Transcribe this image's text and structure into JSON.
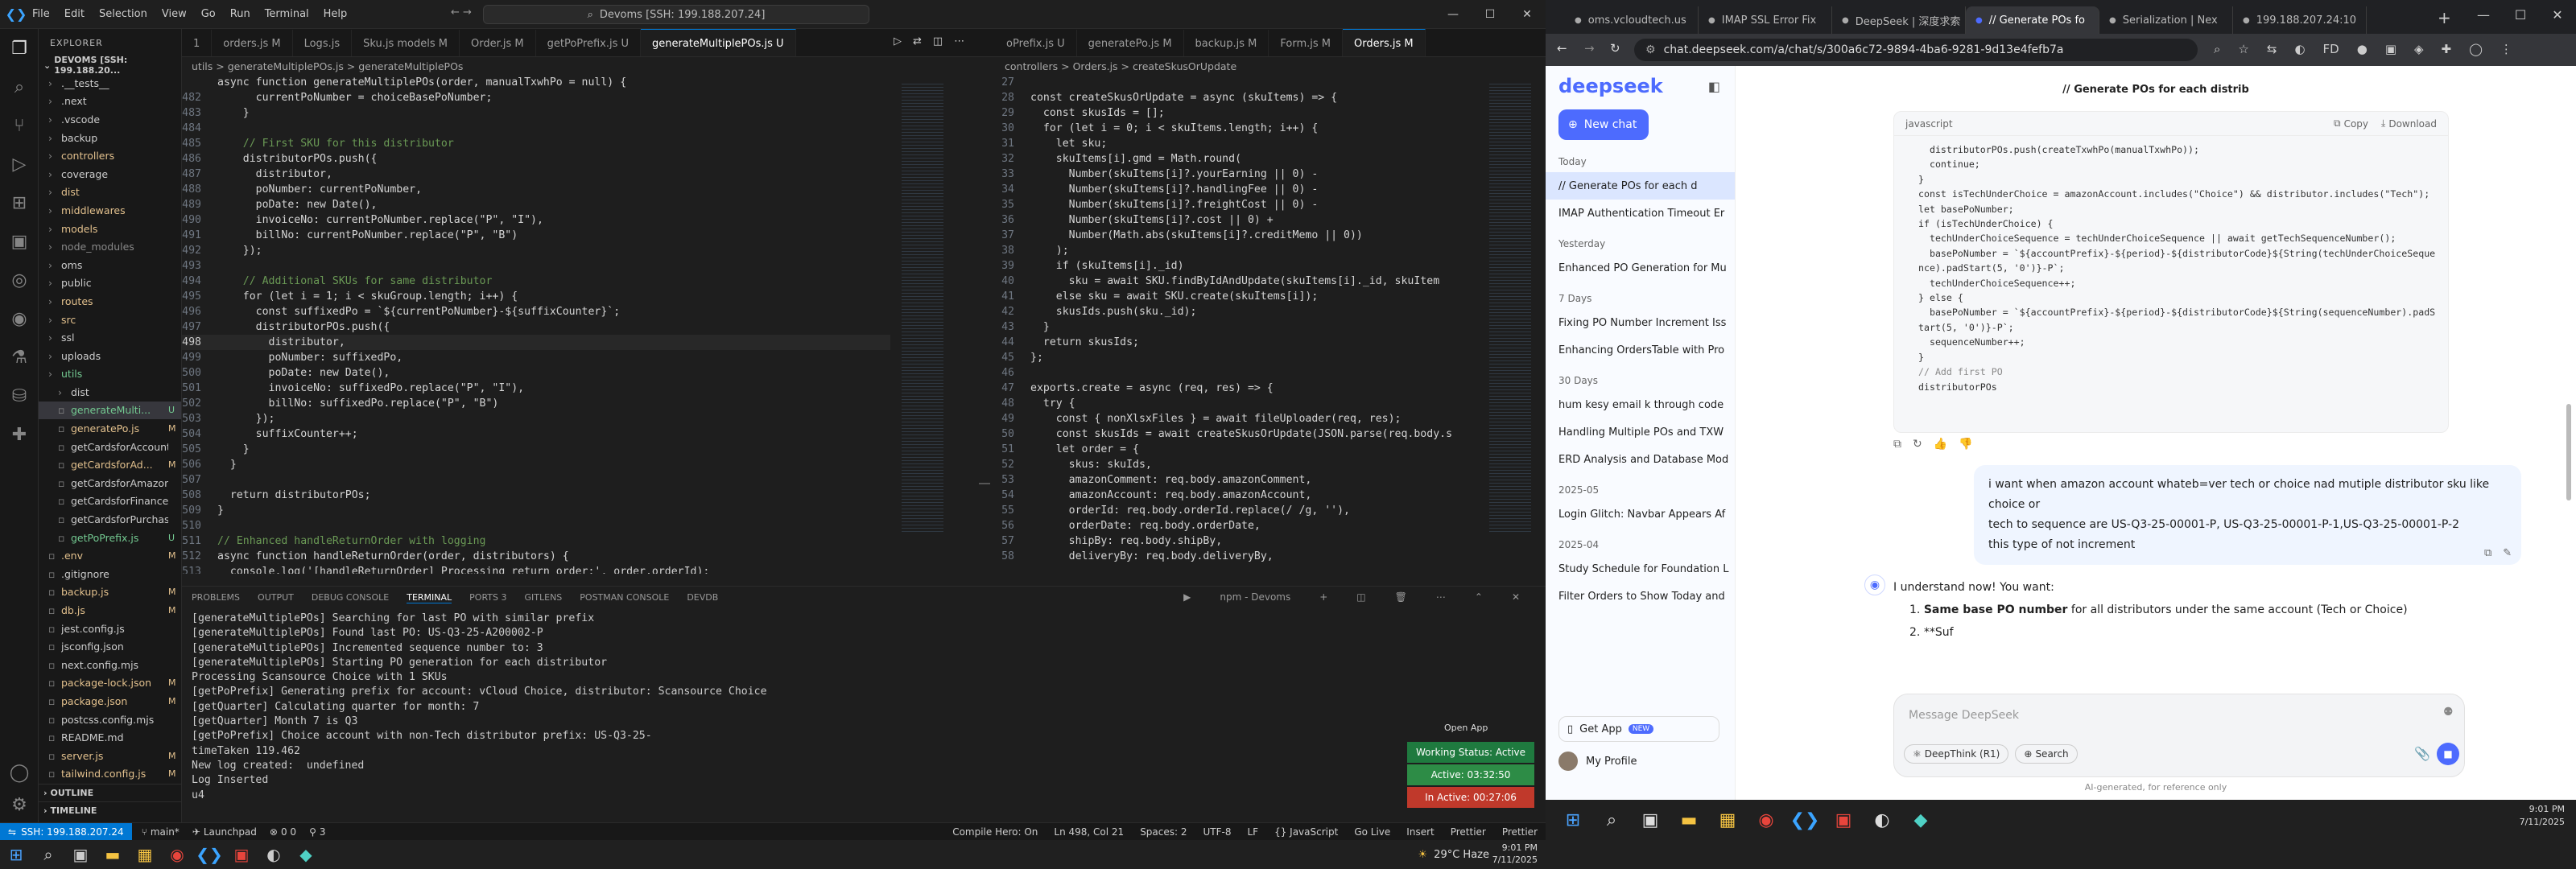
{
  "vscode": {
    "menu": [
      "File",
      "Edit",
      "Selection",
      "View",
      "Go",
      "Run",
      "Terminal",
      "Help"
    ],
    "command_center": "Devoms [SSH: 199.188.207.24]",
    "explorer_title": "EXPLORER",
    "root": "DEVOMS [SSH: 199.188.20...",
    "tree": [
      {
        "name": ".__tests__",
        "badge": "",
        "color": "#ccc",
        "indent": 1
      },
      {
        "name": ".next",
        "badge": "",
        "color": "#ccc",
        "indent": 1
      },
      {
        "name": ".vscode",
        "badge": "",
        "color": "#ccc",
        "indent": 1
      },
      {
        "name": "backup",
        "badge": "",
        "color": "#ccc",
        "indent": 1
      },
      {
        "name": "controllers",
        "badge": "",
        "color": "#e2c08d",
        "indent": 1
      },
      {
        "name": "coverage",
        "badge": "",
        "color": "#ccc",
        "indent": 1
      },
      {
        "name": "dist",
        "badge": "",
        "color": "#e2c08d",
        "indent": 1
      },
      {
        "name": "middlewares",
        "badge": "",
        "color": "#e2c08d",
        "indent": 1
      },
      {
        "name": "models",
        "badge": "",
        "color": "#e2c08d",
        "indent": 1
      },
      {
        "name": "node_modules",
        "badge": "",
        "color": "#888",
        "indent": 1
      },
      {
        "name": "oms",
        "badge": "",
        "color": "#ccc",
        "indent": 1
      },
      {
        "name": "public",
        "badge": "",
        "color": "#ccc",
        "indent": 1
      },
      {
        "name": "routes",
        "badge": "",
        "color": "#e2c08d",
        "indent": 1
      },
      {
        "name": "src",
        "badge": "",
        "color": "#e2c08d",
        "indent": 1
      },
      {
        "name": "ssl",
        "badge": "",
        "color": "#ccc",
        "indent": 1
      },
      {
        "name": "uploads",
        "badge": "",
        "color": "#ccc",
        "indent": 1
      },
      {
        "name": "utils",
        "badge": "",
        "color": "#73c991",
        "indent": 1
      },
      {
        "name": "dist",
        "badge": "",
        "color": "#ccc",
        "indent": 2
      },
      {
        "name": "generateMulti...",
        "badge": "U",
        "color": "#73c991",
        "indent": 2,
        "sel": true
      },
      {
        "name": "generatePo.js",
        "badge": "M",
        "color": "#e2c08d",
        "indent": 2
      },
      {
        "name": "getCardsforAccount.js",
        "badge": "",
        "color": "#ccc",
        "indent": 2
      },
      {
        "name": "getCardsforAd...",
        "badge": "M",
        "color": "#e2c08d",
        "indent": 2
      },
      {
        "name": "getCardsforAmazon.js",
        "badge": "",
        "color": "#ccc",
        "indent": 2
      },
      {
        "name": "getCardsforFinance.js",
        "badge": "",
        "color": "#ccc",
        "indent": 2
      },
      {
        "name": "getCardsforPurchasi...",
        "badge": "",
        "color": "#ccc",
        "indent": 2
      },
      {
        "name": "getPoPrefix.js",
        "badge": "U",
        "color": "#73c991",
        "indent": 2
      },
      {
        "name": ".env",
        "badge": "M",
        "color": "#e2c08d",
        "indent": 1
      },
      {
        "name": ".gitignore",
        "badge": "",
        "color": "#ccc",
        "indent": 1
      },
      {
        "name": "backup.js",
        "badge": "M",
        "color": "#e2c08d",
        "indent": 1
      },
      {
        "name": "db.js",
        "badge": "M",
        "color": "#e2c08d",
        "indent": 1
      },
      {
        "name": "jest.config.js",
        "badge": "",
        "color": "#ccc",
        "indent": 1
      },
      {
        "name": "jsconfig.json",
        "badge": "",
        "color": "#ccc",
        "indent": 1
      },
      {
        "name": "next.config.mjs",
        "badge": "",
        "color": "#ccc",
        "indent": 1
      },
      {
        "name": "package-lock.json",
        "badge": "M",
        "color": "#e2c08d",
        "indent": 1
      },
      {
        "name": "package.json",
        "badge": "M",
        "color": "#e2c08d",
        "indent": 1
      },
      {
        "name": "postcss.config.mjs",
        "badge": "",
        "color": "#ccc",
        "indent": 1
      },
      {
        "name": "README.md",
        "badge": "",
        "color": "#ccc",
        "indent": 1
      },
      {
        "name": "server.js",
        "badge": "M",
        "color": "#e2c08d",
        "indent": 1
      },
      {
        "name": "tailwind.config.js",
        "badge": "M",
        "color": "#e2c08d",
        "indent": 1
      }
    ],
    "outline": "OUTLINE",
    "timeline": "TIMELINE",
    "tabs_left": [
      {
        "label": "1",
        "on": false
      },
      {
        "label": "orders.js M",
        "on": false
      },
      {
        "label": "Logs.js",
        "on": false
      },
      {
        "label": "Sku.js models M",
        "on": false
      },
      {
        "label": "Order.js M",
        "on": false
      },
      {
        "label": "getPoPrefix.js U",
        "on": false
      },
      {
        "label": "generateMultiplePOs.js U",
        "on": true
      }
    ],
    "tabs_right": [
      {
        "label": "oPrefix.js U",
        "on": false
      },
      {
        "label": "generatePo.js M",
        "on": false
      },
      {
        "label": "backup.js M",
        "on": false
      },
      {
        "label": "Form.js M",
        "on": false
      },
      {
        "label": "Orders.js M",
        "on": true
      }
    ],
    "crumb_left": "utils > generateMultiplePOs.js > generateMultiplePOs",
    "crumb_right": "controllers > Orders.js > createSkusOrUpdate",
    "code_left": [
      {
        "n": "",
        "t": "async function generateMultiplePOs(order, manualTxwhPo = null) {"
      },
      {
        "n": "482",
        "t": "      currentPoNumber = choiceBasePoNumber;"
      },
      {
        "n": "483",
        "t": "    }"
      },
      {
        "n": "484",
        "t": ""
      },
      {
        "n": "485",
        "t": "    // First SKU for this distributor"
      },
      {
        "n": "486",
        "t": "    distributorPOs.push({"
      },
      {
        "n": "487",
        "t": "      distributor,"
      },
      {
        "n": "488",
        "t": "      poNumber: currentPoNumber,"
      },
      {
        "n": "489",
        "t": "      poDate: new Date(),"
      },
      {
        "n": "490",
        "t": "      invoiceNo: currentPoNumber.replace(\"P\", \"I\"),"
      },
      {
        "n": "491",
        "t": "      billNo: currentPoNumber.replace(\"P\", \"B\")"
      },
      {
        "n": "492",
        "t": "    });"
      },
      {
        "n": "493",
        "t": ""
      },
      {
        "n": "494",
        "t": "    // Additional SKUs for same distributor"
      },
      {
        "n": "495",
        "t": "    for (let i = 1; i < skuGroup.length; i++) {"
      },
      {
        "n": "496",
        "t": "      const suffixedPo = `${currentPoNumber}-${suffixCounter}`;"
      },
      {
        "n": "497",
        "t": "      distributorPOs.push({"
      },
      {
        "n": "498",
        "t": "        distributor,",
        "cur": true
      },
      {
        "n": "499",
        "t": "        poNumber: suffixedPo,"
      },
      {
        "n": "500",
        "t": "        poDate: new Date(),"
      },
      {
        "n": "501",
        "t": "        invoiceNo: suffixedPo.replace(\"P\", \"I\"),"
      },
      {
        "n": "502",
        "t": "        billNo: suffixedPo.replace(\"P\", \"B\")"
      },
      {
        "n": "503",
        "t": "      });"
      },
      {
        "n": "504",
        "t": "      suffixCounter++;"
      },
      {
        "n": "505",
        "t": "    }"
      },
      {
        "n": "506",
        "t": "  }"
      },
      {
        "n": "507",
        "t": ""
      },
      {
        "n": "508",
        "t": "  return distributorPOs;"
      },
      {
        "n": "509",
        "t": "}"
      },
      {
        "n": "510",
        "t": ""
      },
      {
        "n": "511",
        "t": "// Enhanced handleReturnOrder with logging"
      },
      {
        "n": "512",
        "t": "async function handleReturnOrder(order, distributors) {"
      },
      {
        "n": "513",
        "t": "  console.log('[handleReturnOrder] Processing return order:', order.orderId);"
      }
    ],
    "code_right": [
      {
        "n": "27",
        "t": ""
      },
      {
        "n": "28",
        "t": "const createSkusOrUpdate = async (skuItems) => {"
      },
      {
        "n": "29",
        "t": "  const skusIds = [];"
      },
      {
        "n": "30",
        "t": "  for (let i = 0; i < skuItems.length; i++) {"
      },
      {
        "n": "31",
        "t": "    let sku;"
      },
      {
        "n": "32",
        "t": "    skuItems[i].gmd = Math.round("
      },
      {
        "n": "33",
        "t": "      Number(skuItems[i]?.yourEarning || 0) -"
      },
      {
        "n": "34",
        "t": "      Number(skuItems[i]?.handlingFee || 0) -"
      },
      {
        "n": "35",
        "t": "      Number(skuItems[i]?.freightCost || 0) -"
      },
      {
        "n": "36",
        "t": "      Number(skuItems[i]?.cost || 0) +"
      },
      {
        "n": "37",
        "t": "      Number(Math.abs(skuItems[i]?.creditMemo || 0))"
      },
      {
        "n": "38",
        "t": "    );"
      },
      {
        "n": "39",
        "t": "    if (skuItems[i]._id)"
      },
      {
        "n": "40",
        "t": "      sku = await SKU.findByIdAndUpdate(skuItems[i]._id, skuItem"
      },
      {
        "n": "41",
        "t": "    else sku = await SKU.create(skuItems[i]);"
      },
      {
        "n": "42",
        "t": "    skusIds.push(sku._id);"
      },
      {
        "n": "43",
        "t": "  }"
      },
      {
        "n": "44",
        "t": "  return skusIds;"
      },
      {
        "n": "45",
        "t": "};"
      },
      {
        "n": "46",
        "t": ""
      },
      {
        "n": "47",
        "t": "exports.create = async (req, res) => {"
      },
      {
        "n": "48",
        "t": "  try {"
      },
      {
        "n": "49",
        "t": "    const { nonXlsxFiles } = await fileUploader(req, res);"
      },
      {
        "n": "50",
        "t": "    const skusIds = await createSkusOrUpdate(JSON.parse(req.body.s"
      },
      {
        "n": "51",
        "t": "    let order = {"
      },
      {
        "n": "52",
        "t": "      skus: skuIds,"
      },
      {
        "n": "53",
        "t": "      amazonComment: req.body.amazonComment,"
      },
      {
        "n": "54",
        "t": "      amazonAccount: req.body.amazonAccount,"
      },
      {
        "n": "55",
        "t": "      orderId: req.body.orderId.replace(/ /g, ''),"
      },
      {
        "n": "56",
        "t": "      orderDate: req.body.orderDate,"
      },
      {
        "n": "57",
        "t": "      shipBy: req.body.shipBy,"
      },
      {
        "n": "58",
        "t": "      deliveryBy: req.body.deliveryBy,"
      }
    ],
    "panel_tabs": [
      "PROBLEMS",
      "OUTPUT",
      "DEBUG CONSOLE",
      "TERMINAL",
      "PORTS 3",
      "GITLENS",
      "POSTMAN CONSOLE",
      "DEVDB"
    ],
    "terminal_name": "npm - Devoms",
    "terminal_lines": [
      "[generateMultiplePOs] Searching for last PO with similar prefix",
      "[generateMultiplePOs] Found last PO: US-Q3-25-A200002-P",
      "[generateMultiplePOs] Incremented sequence number to: 3",
      "[generateMultiplePOs] Starting PO generation for each distributor",
      "Processing Scansource Choice with 1 SKUs",
      "[getPoPrefix] Generating prefix for account: vCloud Choice, distributor: Scansource Choice",
      "[getQuarter] Calculating quarter for month: 7",
      "[getQuarter] Month 7 is Q3",
      "[getPoPrefix] Choice account with non-Tech distributor prefix: US-Q3-25-",
      "timeTaken 119.462",
      "New log created:  undefined",
      "Log Inserted",
      "u4"
    ],
    "open_app": "Open App",
    "working_status": "Working Status: Active",
    "active_time": "Active: 03:32:50",
    "inactive_time": "In Active: 00:27:06",
    "status_left": [
      "SSH: 199.188.207.24",
      "main*",
      "Launchpad",
      "0 0",
      "3"
    ],
    "status_right": [
      "Compile Hero: On",
      "Ln 498, Col 21",
      "Spaces: 2",
      "UTF-8",
      "LF",
      "{} JavaScript",
      "Go Live",
      "Insert",
      "Prettier",
      "Prettier"
    ],
    "weather": "29°C Haze",
    "time": "9:01 PM",
    "date": "7/11/2025"
  },
  "chrome": {
    "tabs": [
      {
        "label": "oms.vcloudtech.us",
        "on": false
      },
      {
        "label": "IMAP SSL Error Fix",
        "on": false
      },
      {
        "label": "DeepSeek | 深度求索",
        "on": false
      },
      {
        "label": "// Generate POs fo",
        "on": true
      },
      {
        "label": "Serialization | Nex",
        "on": false
      },
      {
        "label": "199.188.207.24:10",
        "on": false
      }
    ],
    "url": "chat.deepseek.com/a/chat/s/300a6c72-9894-4ba6-9281-9d13e4fefb7a"
  },
  "deepseek": {
    "logo": "deepseek",
    "new_chat": "New chat",
    "sections": [
      {
        "title": "Today",
        "items": [
          "// Generate POs for each d",
          "IMAP Authentication Timeout Er"
        ]
      },
      {
        "title": "Yesterday",
        "items": [
          "Enhanced PO Generation for Mu"
        ]
      },
      {
        "title": "7 Days",
        "items": [
          "Fixing PO Number Increment Iss",
          "Enhancing OrdersTable with Pro"
        ]
      },
      {
        "title": "30 Days",
        "items": [
          "hum kesy email k through code",
          "Handling Multiple POs and TXW",
          "ERD Analysis and Database Mod"
        ]
      },
      {
        "title": "2025-05",
        "items": [
          "Login Glitch: Navbar Appears Af"
        ]
      },
      {
        "title": "2025-04",
        "items": [
          "Study Schedule for Foundation L",
          "Filter Orders to Show Today and"
        ]
      }
    ],
    "get_app": "Get App",
    "new_badge": "NEW",
    "profile": "My Profile",
    "chat_title": "// Generate POs for each distrib",
    "code_lang": "javascript",
    "copy": "Copy",
    "download": "Download",
    "code_lines": [
      "  distributorPOs.push(createTxwhPo(manualTxwhPo));",
      "  continue;",
      "}",
      "",
      "const isTechUnderChoice = amazonAccount.includes(\"Choice\") && distributor.includes(\"Tech\");",
      "",
      "let basePoNumber;",
      "if (isTechUnderChoice) {",
      "  techUnderChoiceSequence = techUnderChoiceSequence || await getTechSequenceNumber();",
      "  basePoNumber = `${accountPrefix}-${period}-${distributorCode}${String(techUnderChoiceSeque",
      "nce).padStart(5, '0')}-P`;",
      "  techUnderChoiceSequence++;",
      "} else {",
      "  basePoNumber = `${accountPrefix}-${period}-${distributorCode}${String(sequenceNumber).padS",
      "tart(5, '0')}-P`;",
      "  sequenceNumber++;",
      "}",
      "",
      "// Add first PO",
      "distributorPOs"
    ],
    "user_msg": [
      "i want when amazon account whateb=ver tech or choice nad mutiple distributor sku like choice or",
      "tech to sequence are US-Q3-25-00001-P, US-Q3-25-00001-P-1,US-Q3-25-00001-P-2",
      "this type of not increment"
    ],
    "reply_intro": "I understand now! You want:",
    "reply_item1_bold": "Same base PO number",
    "reply_item1_rest": " for all distributors under the same account (Tech or Choice)",
    "reply_item2": "**Suf",
    "placeholder": "Message DeepSeek",
    "deepthink": "DeepThink (R1)",
    "search": "Search",
    "disclaimer": "AI-generated, for reference only",
    "time": "9:01 PM",
    "date": "7/11/2025"
  }
}
